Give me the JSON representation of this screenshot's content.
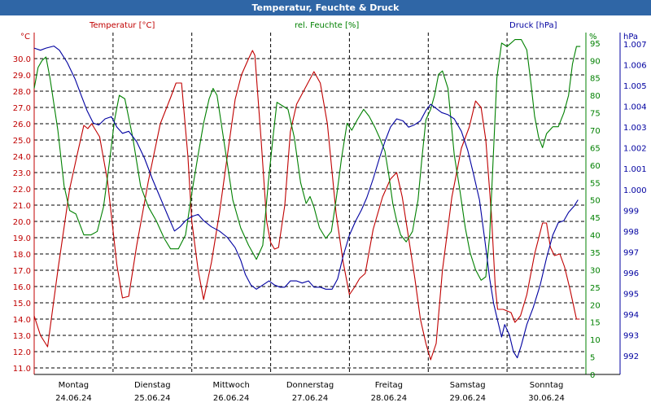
{
  "window": {
    "title": "Temperatur, Feuchte & Druck"
  },
  "chart_data": {
    "type": "line",
    "title": "Temperatur, Feuchte & Druck",
    "colors": {
      "temperature": "#c00000",
      "humidity": "#008000",
      "pressure": "#0000a0",
      "grid": "#000000",
      "title_bar": "#2f66a6"
    },
    "grid": true,
    "axes": {
      "left": {
        "unit": "°C",
        "label": "Temperatur [°C]",
        "range": [
          10.6,
          31.6
        ],
        "ticks": [
          "11.0",
          "12.0",
          "13.0",
          "14.0",
          "15.0",
          "16.0",
          "17.0",
          "18.0",
          "19.0",
          "20.0",
          "21.0",
          "22.0",
          "23.0",
          "24.0",
          "25.0",
          "26.0",
          "27.0",
          "28.0",
          "29.0",
          "30.0"
        ]
      },
      "middle": {
        "unit": "%",
        "label": "rel. Feuchte [%]",
        "range": [
          0,
          98
        ],
        "ticks": [
          "0",
          "5",
          "10",
          "15",
          "20",
          "25",
          "30",
          "35",
          "40",
          "45",
          "50",
          "55",
          "60",
          "65",
          "70",
          "75",
          "80",
          "85",
          "90",
          "95"
        ]
      },
      "right": {
        "unit": "hPa",
        "label": "Druck [hPa]",
        "range": [
          991.1,
          1007.55
        ],
        "ticks": [
          "992",
          "993",
          "994",
          "995",
          "996",
          "997",
          "998",
          "999",
          "1.000",
          "1.001",
          "1.002",
          "1.003",
          "1.004",
          "1.005",
          "1.006",
          "1.007"
        ]
      }
    },
    "x": {
      "range": [
        0,
        7
      ],
      "days": [
        {
          "weekday": "Montag",
          "date": "24.06.24"
        },
        {
          "weekday": "Dienstag",
          "date": "25.06.24"
        },
        {
          "weekday": "Mittwoch",
          "date": "26.06.24"
        },
        {
          "weekday": "Donnerstag",
          "date": "27.06.24"
        },
        {
          "weekday": "Freitag",
          "date": "28.06.24"
        },
        {
          "weekday": "Samstag",
          "date": "29.06.24"
        },
        {
          "weekday": "Sonntag",
          "date": "30.06.24"
        }
      ]
    },
    "series": [
      {
        "name": "Temperatur [°C]",
        "axis": "left",
        "color": "#c00000",
        "points": [
          [
            0.0,
            14.2
          ],
          [
            0.08,
            13.0
          ],
          [
            0.17,
            12.3
          ],
          [
            0.3,
            17.0
          ],
          [
            0.45,
            22.0
          ],
          [
            0.55,
            24.2
          ],
          [
            0.63,
            25.9
          ],
          [
            0.68,
            25.7
          ],
          [
            0.73,
            26.0
          ],
          [
            0.83,
            25.2
          ],
          [
            0.93,
            22.5
          ],
          [
            1.05,
            17.3
          ],
          [
            1.12,
            15.3
          ],
          [
            1.2,
            15.4
          ],
          [
            1.3,
            18.5
          ],
          [
            1.45,
            22.5
          ],
          [
            1.6,
            26.0
          ],
          [
            1.73,
            27.6
          ],
          [
            1.8,
            28.5
          ],
          [
            1.87,
            28.5
          ],
          [
            1.95,
            24.0
          ],
          [
            2.0,
            20.0
          ],
          [
            2.08,
            17.0
          ],
          [
            2.15,
            15.2
          ],
          [
            2.25,
            17.5
          ],
          [
            2.35,
            20.5
          ],
          [
            2.45,
            24.0
          ],
          [
            2.55,
            27.5
          ],
          [
            2.63,
            29.0
          ],
          [
            2.72,
            30.0
          ],
          [
            2.77,
            30.5
          ],
          [
            2.8,
            30.2
          ],
          [
            2.88,
            25.0
          ],
          [
            2.95,
            20.0
          ],
          [
            3.0,
            18.7
          ],
          [
            3.05,
            18.3
          ],
          [
            3.1,
            18.4
          ],
          [
            3.18,
            21.0
          ],
          [
            3.25,
            25.5
          ],
          [
            3.33,
            27.2
          ],
          [
            3.45,
            28.3
          ],
          [
            3.55,
            29.2
          ],
          [
            3.63,
            28.5
          ],
          [
            3.72,
            26.0
          ],
          [
            3.83,
            20.5
          ],
          [
            3.92,
            17.5
          ],
          [
            4.0,
            15.5
          ],
          [
            4.07,
            16.0
          ],
          [
            4.13,
            16.5
          ],
          [
            4.2,
            16.8
          ],
          [
            4.3,
            19.5
          ],
          [
            4.42,
            21.5
          ],
          [
            4.52,
            22.6
          ],
          [
            4.6,
            23.0
          ],
          [
            4.67,
            21.5
          ],
          [
            4.75,
            19.0
          ],
          [
            4.83,
            16.5
          ],
          [
            4.9,
            14.0
          ],
          [
            4.97,
            12.5
          ],
          [
            5.03,
            11.5
          ],
          [
            5.1,
            12.5
          ],
          [
            5.18,
            17.0
          ],
          [
            5.3,
            21.5
          ],
          [
            5.42,
            24.5
          ],
          [
            5.52,
            25.8
          ],
          [
            5.6,
            27.4
          ],
          [
            5.67,
            27.0
          ],
          [
            5.73,
            25.0
          ],
          [
            5.8,
            20.5
          ],
          [
            5.85,
            16.0
          ],
          [
            5.88,
            14.6
          ],
          [
            5.95,
            14.6
          ],
          [
            6.05,
            14.4
          ],
          [
            6.1,
            13.8
          ],
          [
            6.17,
            14.2
          ],
          [
            6.25,
            15.5
          ],
          [
            6.35,
            18.0
          ],
          [
            6.45,
            19.9
          ],
          [
            6.5,
            19.9
          ],
          [
            6.55,
            18.4
          ],
          [
            6.6,
            17.9
          ],
          [
            6.67,
            18.0
          ],
          [
            6.73,
            17.2
          ],
          [
            6.8,
            15.8
          ],
          [
            6.88,
            14.0
          ],
          [
            6.92,
            14.0
          ]
        ]
      },
      {
        "name": "rel. Feuchte [%]",
        "axis": "middle",
        "color": "#008000",
        "points": [
          [
            0.0,
            82
          ],
          [
            0.05,
            88
          ],
          [
            0.1,
            90
          ],
          [
            0.15,
            91
          ],
          [
            0.2,
            85
          ],
          [
            0.3,
            70
          ],
          [
            0.38,
            54
          ],
          [
            0.45,
            47
          ],
          [
            0.53,
            46
          ],
          [
            0.63,
            40
          ],
          [
            0.72,
            40
          ],
          [
            0.8,
            41
          ],
          [
            0.88,
            48
          ],
          [
            0.95,
            60
          ],
          [
            1.02,
            73
          ],
          [
            1.08,
            80
          ],
          [
            1.15,
            79
          ],
          [
            1.25,
            68
          ],
          [
            1.35,
            54
          ],
          [
            1.45,
            48
          ],
          [
            1.55,
            44
          ],
          [
            1.65,
            39
          ],
          [
            1.73,
            36
          ],
          [
            1.83,
            36
          ],
          [
            1.92,
            40
          ],
          [
            2.0,
            52
          ],
          [
            2.08,
            63
          ],
          [
            2.15,
            72
          ],
          [
            2.22,
            79
          ],
          [
            2.27,
            82
          ],
          [
            2.32,
            80
          ],
          [
            2.42,
            65
          ],
          [
            2.52,
            50
          ],
          [
            2.62,
            42
          ],
          [
            2.72,
            37
          ],
          [
            2.82,
            33
          ],
          [
            2.9,
            37
          ],
          [
            2.97,
            55
          ],
          [
            3.03,
            68
          ],
          [
            3.08,
            78
          ],
          [
            3.15,
            77
          ],
          [
            3.22,
            76
          ],
          [
            3.3,
            68
          ],
          [
            3.38,
            55
          ],
          [
            3.45,
            49
          ],
          [
            3.5,
            51
          ],
          [
            3.55,
            48
          ],
          [
            3.62,
            42
          ],
          [
            3.7,
            39
          ],
          [
            3.77,
            41
          ],
          [
            3.83,
            50
          ],
          [
            3.9,
            62
          ],
          [
            3.97,
            72
          ],
          [
            4.03,
            70
          ],
          [
            4.1,
            73
          ],
          [
            4.18,
            76
          ],
          [
            4.25,
            74
          ],
          [
            4.32,
            71
          ],
          [
            4.38,
            68
          ],
          [
            4.45,
            64
          ],
          [
            4.5,
            57
          ],
          [
            4.55,
            49
          ],
          [
            4.6,
            44
          ],
          [
            4.65,
            40
          ],
          [
            4.72,
            38
          ],
          [
            4.8,
            41
          ],
          [
            4.87,
            50
          ],
          [
            4.92,
            62
          ],
          [
            4.97,
            73
          ],
          [
            5.03,
            76
          ],
          [
            5.08,
            80
          ],
          [
            5.13,
            86
          ],
          [
            5.18,
            87
          ],
          [
            5.25,
            82
          ],
          [
            5.33,
            63
          ],
          [
            5.4,
            53
          ],
          [
            5.47,
            42
          ],
          [
            5.53,
            35
          ],
          [
            5.6,
            30
          ],
          [
            5.67,
            27
          ],
          [
            5.73,
            28
          ],
          [
            5.78,
            40
          ],
          [
            5.82,
            60
          ],
          [
            5.87,
            85
          ],
          [
            5.93,
            95
          ],
          [
            6.0,
            94
          ],
          [
            6.05,
            95
          ],
          [
            6.1,
            96
          ],
          [
            6.18,
            96
          ],
          [
            6.25,
            93
          ],
          [
            6.3,
            84
          ],
          [
            6.35,
            74
          ],
          [
            6.4,
            68
          ],
          [
            6.45,
            65
          ],
          [
            6.5,
            69
          ],
          [
            6.58,
            71
          ],
          [
            6.65,
            71
          ],
          [
            6.72,
            75
          ],
          [
            6.78,
            80
          ],
          [
            6.83,
            89
          ],
          [
            6.88,
            94
          ],
          [
            6.93,
            94
          ]
        ]
      },
      {
        "name": "Druck [hPa]",
        "axis": "right",
        "color": "#0000a0",
        "points": [
          [
            0.0,
            1006.8
          ],
          [
            0.08,
            1006.7
          ],
          [
            0.15,
            1006.8
          ],
          [
            0.25,
            1006.9
          ],
          [
            0.32,
            1006.7
          ],
          [
            0.42,
            1006.1
          ],
          [
            0.52,
            1005.3
          ],
          [
            0.6,
            1004.5
          ],
          [
            0.67,
            1003.8
          ],
          [
            0.75,
            1003.2
          ],
          [
            0.82,
            1003.1
          ],
          [
            0.9,
            1003.4
          ],
          [
            0.98,
            1003.5
          ],
          [
            1.05,
            1003.0
          ],
          [
            1.12,
            1002.7
          ],
          [
            1.2,
            1002.8
          ],
          [
            1.3,
            1002.3
          ],
          [
            1.4,
            1001.5
          ],
          [
            1.5,
            1000.5
          ],
          [
            1.6,
            999.6
          ],
          [
            1.7,
            998.7
          ],
          [
            1.78,
            998.0
          ],
          [
            1.85,
            998.2
          ],
          [
            1.92,
            998.5
          ],
          [
            2.0,
            998.7
          ],
          [
            2.08,
            998.8
          ],
          [
            2.15,
            998.5
          ],
          [
            2.25,
            998.2
          ],
          [
            2.35,
            998.0
          ],
          [
            2.45,
            997.7
          ],
          [
            2.55,
            997.2
          ],
          [
            2.62,
            996.6
          ],
          [
            2.68,
            995.9
          ],
          [
            2.75,
            995.4
          ],
          [
            2.82,
            995.2
          ],
          [
            2.9,
            995.4
          ],
          [
            2.98,
            995.6
          ],
          [
            3.05,
            995.4
          ],
          [
            3.12,
            995.3
          ],
          [
            3.18,
            995.3
          ],
          [
            3.25,
            995.6
          ],
          [
            3.33,
            995.6
          ],
          [
            3.4,
            995.5
          ],
          [
            3.48,
            995.6
          ],
          [
            3.55,
            995.3
          ],
          [
            3.63,
            995.3
          ],
          [
            3.7,
            995.2
          ],
          [
            3.78,
            995.2
          ],
          [
            3.85,
            995.7
          ],
          [
            3.92,
            996.8
          ],
          [
            4.0,
            997.8
          ],
          [
            4.08,
            998.5
          ],
          [
            4.15,
            999.0
          ],
          [
            4.22,
            999.6
          ],
          [
            4.3,
            1000.5
          ],
          [
            4.38,
            1001.5
          ],
          [
            4.45,
            1002.3
          ],
          [
            4.52,
            1003.0
          ],
          [
            4.6,
            1003.4
          ],
          [
            4.68,
            1003.3
          ],
          [
            4.75,
            1003.0
          ],
          [
            4.82,
            1003.1
          ],
          [
            4.9,
            1003.3
          ],
          [
            4.97,
            1003.8
          ],
          [
            5.03,
            1004.1
          ],
          [
            5.1,
            1003.9
          ],
          [
            5.17,
            1003.7
          ],
          [
            5.25,
            1003.6
          ],
          [
            5.33,
            1003.4
          ],
          [
            5.42,
            1002.8
          ],
          [
            5.5,
            1001.9
          ],
          [
            5.57,
            1000.8
          ],
          [
            5.65,
            999.5
          ],
          [
            5.72,
            997.5
          ],
          [
            5.78,
            995.7
          ],
          [
            5.83,
            994.5
          ],
          [
            5.88,
            993.7
          ],
          [
            5.93,
            992.9
          ],
          [
            5.97,
            993.5
          ],
          [
            6.03,
            993.0
          ],
          [
            6.08,
            992.2
          ],
          [
            6.13,
            991.9
          ],
          [
            6.18,
            992.5
          ],
          [
            6.25,
            993.5
          ],
          [
            6.33,
            994.3
          ],
          [
            6.42,
            995.4
          ],
          [
            6.5,
            996.7
          ],
          [
            6.58,
            997.8
          ],
          [
            6.65,
            998.4
          ],
          [
            6.72,
            998.5
          ],
          [
            6.78,
            998.9
          ],
          [
            6.85,
            999.2
          ],
          [
            6.9,
            999.5
          ]
        ]
      }
    ]
  }
}
